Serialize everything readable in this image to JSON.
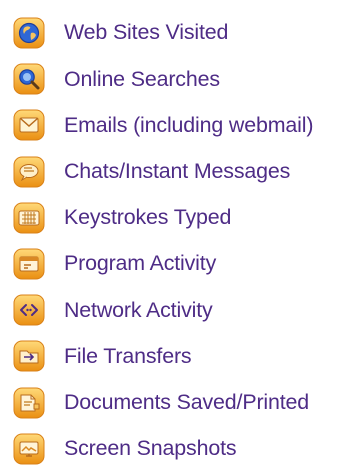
{
  "features": [
    {
      "label": "Web Sites Visited",
      "icon": "globe-icon"
    },
    {
      "label": "Online Searches",
      "icon": "magnifier-globe-icon"
    },
    {
      "label": "Emails (including webmail)",
      "icon": "envelope-icon"
    },
    {
      "label": "Chats/Instant Messages",
      "icon": "chat-bubble-icon"
    },
    {
      "label": "Keystrokes Typed",
      "icon": "keyboard-icon"
    },
    {
      "label": "Program Activity",
      "icon": "program-window-icon"
    },
    {
      "label": "Network Activity",
      "icon": "network-arrows-icon"
    },
    {
      "label": "File Transfers",
      "icon": "folder-transfer-icon"
    },
    {
      "label": "Documents Saved/Printed",
      "icon": "document-printer-icon"
    },
    {
      "label": "Screen Snapshots",
      "icon": "monitor-snapshot-icon"
    }
  ],
  "colors": {
    "label_text": "#4e2c86",
    "icon_orange": "#f2a21e",
    "icon_orange_dark": "#d77d12",
    "icon_blue": "#2b57c6"
  }
}
